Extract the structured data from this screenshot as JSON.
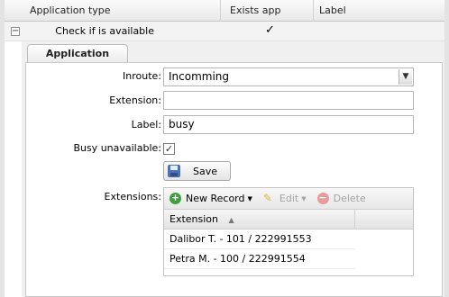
{
  "grid": {
    "columns": [
      "Application type",
      "Exists app config",
      "Label"
    ],
    "row": {
      "expander": "−",
      "app_type": "Check if is available",
      "exists_mark": "✓",
      "label": ""
    }
  },
  "tab": {
    "label": "Application config"
  },
  "form": {
    "inroute_label": "Inroute:",
    "inroute_value": "Incomming",
    "extension_label": "Extension:",
    "extension_value": "",
    "label_label": "Label:",
    "label_value": "busy",
    "busy_label": "Busy unavailable:",
    "busy_checked_mark": "✓",
    "save_label": "Save",
    "extensions_label": "Extensions:"
  },
  "extensions": {
    "toolbar": {
      "new_label": "New Record",
      "edit_label": "Edit",
      "delete_label": "Delete"
    },
    "column": "Extension",
    "rows": [
      "Dalibor T. - 101 / 222991553",
      "Petra M. - 100 / 222991554"
    ]
  }
}
